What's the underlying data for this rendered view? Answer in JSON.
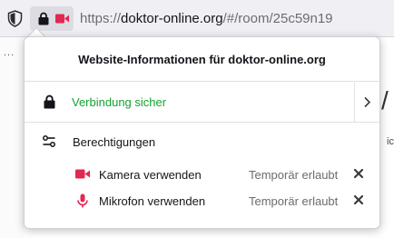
{
  "urlbar": {
    "url_prefix": "https://",
    "url_domain": "doktor-online.org",
    "url_path": "/#/room/25c59n19"
  },
  "background": {
    "dots": "...",
    "slash": "/",
    "side_text": "ic"
  },
  "panel": {
    "title": "Website-Informationen für doktor-online.org",
    "connection": {
      "label": "Verbindung sicher"
    },
    "permissions": {
      "heading": "Berechtigungen",
      "items": [
        {
          "label": "Kamera verwenden",
          "state": "Temporär erlaubt"
        },
        {
          "label": "Mikrofon verwenden",
          "state": "Temporär erlaubt"
        }
      ]
    }
  },
  "colors": {
    "secure_green": "#12a330",
    "permission_red": "#e22850"
  },
  "icons": [
    "shield-icon",
    "lock-icon",
    "camera-icon",
    "chevron-right-icon",
    "permissions-icon",
    "microphone-icon",
    "close-icon"
  ]
}
